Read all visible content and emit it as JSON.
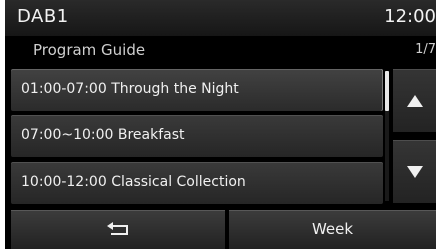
{
  "status": {
    "source": "DAB1",
    "clock": "12:00"
  },
  "guide": {
    "title": "Program Guide",
    "page": "1/7"
  },
  "programs": [
    {
      "label": "01:00-07:00 Through the Night",
      "selected": true
    },
    {
      "label": "07:00~10:00 Breakfast",
      "selected": false
    },
    {
      "label": "10:00-12:00 Classical Collection",
      "selected": false
    }
  ],
  "controls": {
    "scroll_up_icon": "triangle-up-icon",
    "scroll_down_icon": "triangle-down-icon",
    "back_icon": "return-arrow-icon",
    "week_label": "Week"
  },
  "colors": {
    "background": "#000000",
    "text": "#f0f0f0",
    "button": "#2e2e2e"
  }
}
